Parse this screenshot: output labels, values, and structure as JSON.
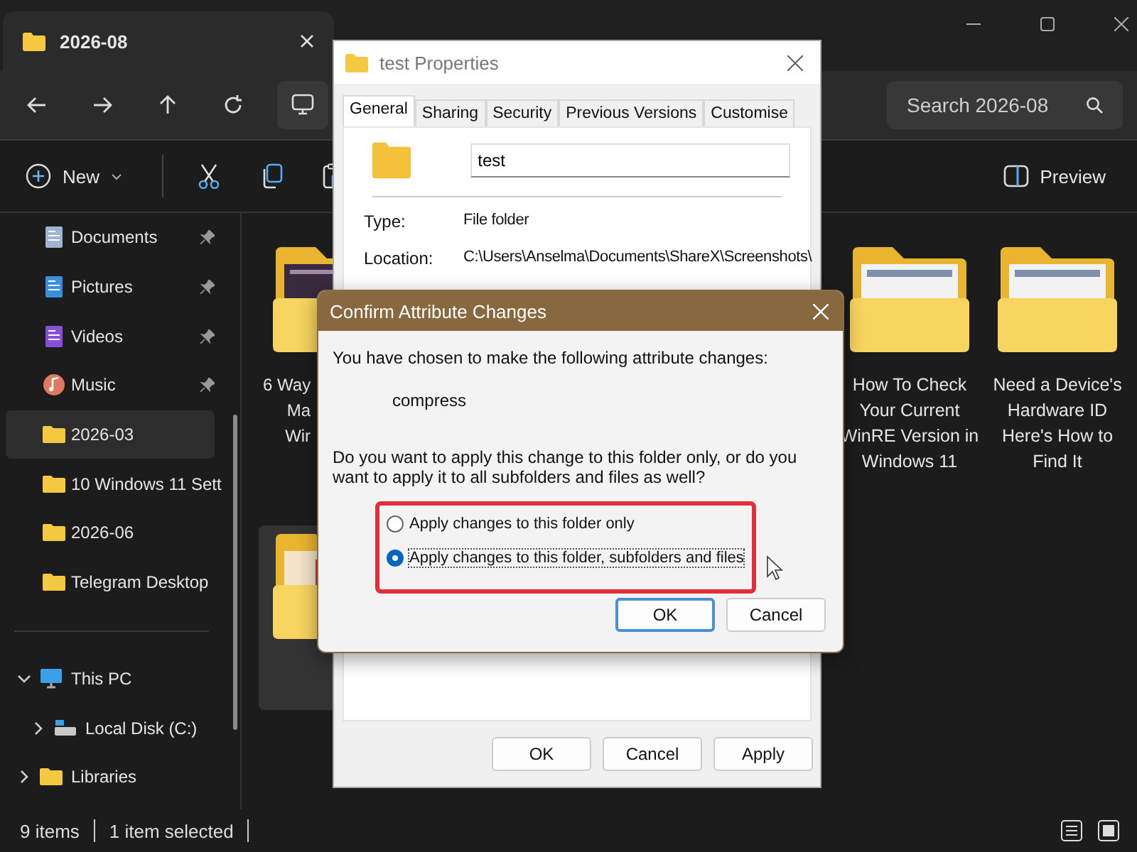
{
  "explorer": {
    "tab": {
      "title": "2026-08"
    },
    "search": {
      "placeholder": "Search 2026-08"
    },
    "commands": {
      "new_label": "New",
      "preview_label": "Preview"
    },
    "sidebar": {
      "items": [
        {
          "label": "Documents",
          "kind": "documents",
          "pinned": true,
          "selected": false
        },
        {
          "label": "Pictures",
          "kind": "pictures",
          "pinned": true,
          "selected": false
        },
        {
          "label": "Videos",
          "kind": "videos",
          "pinned": true,
          "selected": false
        },
        {
          "label": "Music",
          "kind": "music",
          "pinned": true,
          "selected": false
        },
        {
          "label": "2026-03",
          "kind": "folder",
          "pinned": false,
          "selected": true
        },
        {
          "label": "10 Windows 11 Sett",
          "kind": "folder",
          "pinned": false,
          "selected": false
        },
        {
          "label": "2026-06",
          "kind": "folder",
          "pinned": false,
          "selected": false
        },
        {
          "label": "Telegram Desktop",
          "kind": "folder",
          "pinned": false,
          "selected": false
        }
      ],
      "tree": [
        {
          "label": "This PC",
          "kind": "pc",
          "expanded": true,
          "selected": false,
          "children": [
            {
              "label": "Local Disk (C:)",
              "kind": "disk",
              "expanded": false,
              "selected": false
            }
          ]
        },
        {
          "label": "Libraries",
          "kind": "folder",
          "expanded": false,
          "selected": false
        }
      ]
    },
    "content": {
      "rows": [
        {
          "items": [
            {
              "label": "6 Way\nMa\nWir",
              "kind": "dark",
              "selected": false
            },
            {
              "label": "How To Check Your Current WinRE Version in Windows 11",
              "kind": "light",
              "selected": false
            },
            {
              "label": "Need a Device's Hardware ID Here's How to Find It",
              "kind": "light",
              "selected": false
            }
          ]
        },
        {
          "items": [
            {
              "kind": "document",
              "selected": true
            }
          ]
        }
      ]
    },
    "status_bar": {
      "count": "9 items",
      "selection": "1 item selected"
    }
  },
  "properties_dialog": {
    "title": "test Properties",
    "tabs": [
      {
        "label": "General",
        "selected": true
      },
      {
        "label": "Sharing",
        "selected": false
      },
      {
        "label": "Security",
        "selected": false
      },
      {
        "label": "Previous Versions",
        "selected": false
      },
      {
        "label": "Customise",
        "selected": false
      }
    ],
    "name": "test",
    "fields": [
      {
        "label": "Type:",
        "value": "File folder"
      },
      {
        "label": "Location:",
        "value": "C:\\Users\\Anselma\\Documents\\ShareX\\Screenshots\\"
      }
    ],
    "buttons": [
      {
        "label": "OK",
        "default": false
      },
      {
        "label": "Cancel",
        "default": false
      },
      {
        "label": "Apply",
        "default": false
      }
    ]
  },
  "confirm_dialog": {
    "title": "Confirm Attribute Changes",
    "message": "You have chosen to make the following attribute changes:",
    "attribute": "compress",
    "question": "Do you want to apply this change to this folder only, or do you want to apply it to all subfolders and files as well?",
    "options": [
      {
        "label": "Apply changes to this folder only",
        "selected": false
      },
      {
        "label": "Apply changes to this folder, subfolders and files",
        "selected": true
      }
    ],
    "buttons": [
      {
        "label": "OK",
        "default": true
      },
      {
        "label": "Cancel",
        "default": false
      }
    ]
  }
}
